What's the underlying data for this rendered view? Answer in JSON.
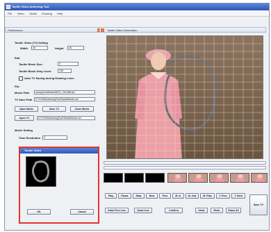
{
  "window": {
    "title": "Tactile Video Authoring Tool"
  },
  "menu": [
    "File",
    "Video",
    "Tactile",
    "Drawing",
    "Help"
  ],
  "left_panel": {
    "title": "Preferences",
    "tactile_setting": {
      "header": "Tactile Video (TV) Setting",
      "width_label": "Width",
      "width_value": "16",
      "height_label": "Height",
      "height_value": "16"
    },
    "edit": {
      "header": "Edit",
      "block_size_label": "Tactile Block Size:",
      "block_size_value": "3",
      "gray_level_label": "Tactile Block Gray Level:",
      "gray_level_value": "128",
      "auto_label": "Auto TV Saving during Drawing Lines"
    },
    "file": {
      "header": "File",
      "movie_path_label": "Movie Path",
      "movie_path_value": "ouringTool\\Movie\\MOV_C01268.avi",
      "tv_save_path_label": "TV Save Path",
      "tv_save_path_value": "D:\\TV\\WAuthoringTool\\TactileMovie.avi",
      "open_movie": "Open Movie",
      "save_tv": "Save TV",
      "close_movie": "Close Movie",
      "open_tv": "Open TV",
      "open_tv_path": "D:\\TV\\WAuthoringTool\\TactileMovie.avi"
    },
    "movie_setting": {
      "header": "Movie Setting",
      "time_resolution_label": "Time Resolution",
      "time_resolution_value": "3",
      "opt1": "St",
      "opt2": "Vd"
    }
  },
  "right_panel": {
    "title": "Tactile Video Generation"
  },
  "thumbnails": {
    "black_count": 3,
    "pink_count": 5
  },
  "controls": {
    "row1": [
      "Play",
      "Pause",
      "Stop",
      "Next",
      "Prev",
      "M. In",
      "M. Out",
      "M. Play",
      "T. Prev",
      "T. Next"
    ],
    "row2": [
      "Draw Free Line",
      "Draw Line",
      "Confirm",
      "Undo",
      "Redo",
      "Erase All"
    ],
    "save_tv": "Save TV"
  },
  "dialog": {
    "title": "Tactile Video",
    "ok": "OK",
    "cancel": "Cancel"
  }
}
